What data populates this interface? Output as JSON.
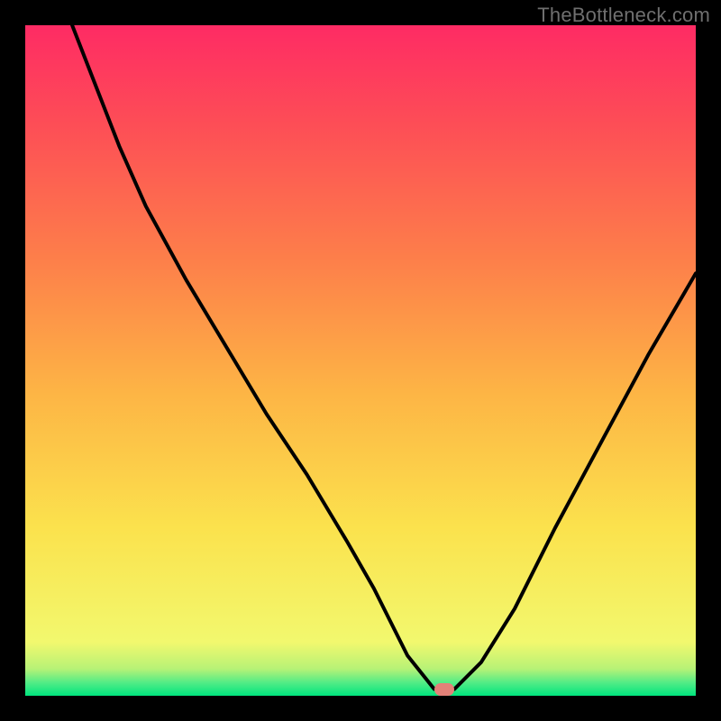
{
  "watermark": "TheBottleneck.com",
  "colors": {
    "page_bg": "#000000",
    "gradient_top": "#fe2b64",
    "gradient_bottom": "#00e57e",
    "curve_stroke": "#000000",
    "marker_fill": "#e38178",
    "watermark_text": "#6f6f6f"
  },
  "chart_data": {
    "type": "line",
    "title": "",
    "xlabel": "",
    "ylabel": "",
    "xlim": [
      0,
      100
    ],
    "ylim": [
      0,
      100
    ],
    "grid": false,
    "legend": false,
    "series": [
      {
        "name": "bottleneck-curve",
        "x": [
          7,
          14,
          18,
          24,
          30,
          36,
          42,
          48,
          52,
          55,
          57,
          61,
          64,
          68,
          73,
          79,
          86,
          93,
          100
        ],
        "y": [
          100,
          82,
          73,
          62,
          52,
          42,
          33,
          23,
          16,
          10,
          6,
          1,
          1,
          5,
          13,
          25,
          38,
          51,
          63
        ]
      }
    ],
    "markers": [
      {
        "name": "optimal-point",
        "x": 62.5,
        "y": 1
      }
    ],
    "background_gradient": {
      "direction": "vertical",
      "stops": [
        {
          "pos": 0.0,
          "color": "#fe2b64"
        },
        {
          "pos": 0.15,
          "color": "#fd4e56"
        },
        {
          "pos": 0.35,
          "color": "#fd7f4a"
        },
        {
          "pos": 0.55,
          "color": "#fdb545"
        },
        {
          "pos": 0.75,
          "color": "#fbe24d"
        },
        {
          "pos": 0.92,
          "color": "#f2f86e"
        },
        {
          "pos": 0.96,
          "color": "#b6f276"
        },
        {
          "pos": 0.98,
          "color": "#54ec86"
        },
        {
          "pos": 1.0,
          "color": "#00e57e"
        }
      ]
    }
  }
}
